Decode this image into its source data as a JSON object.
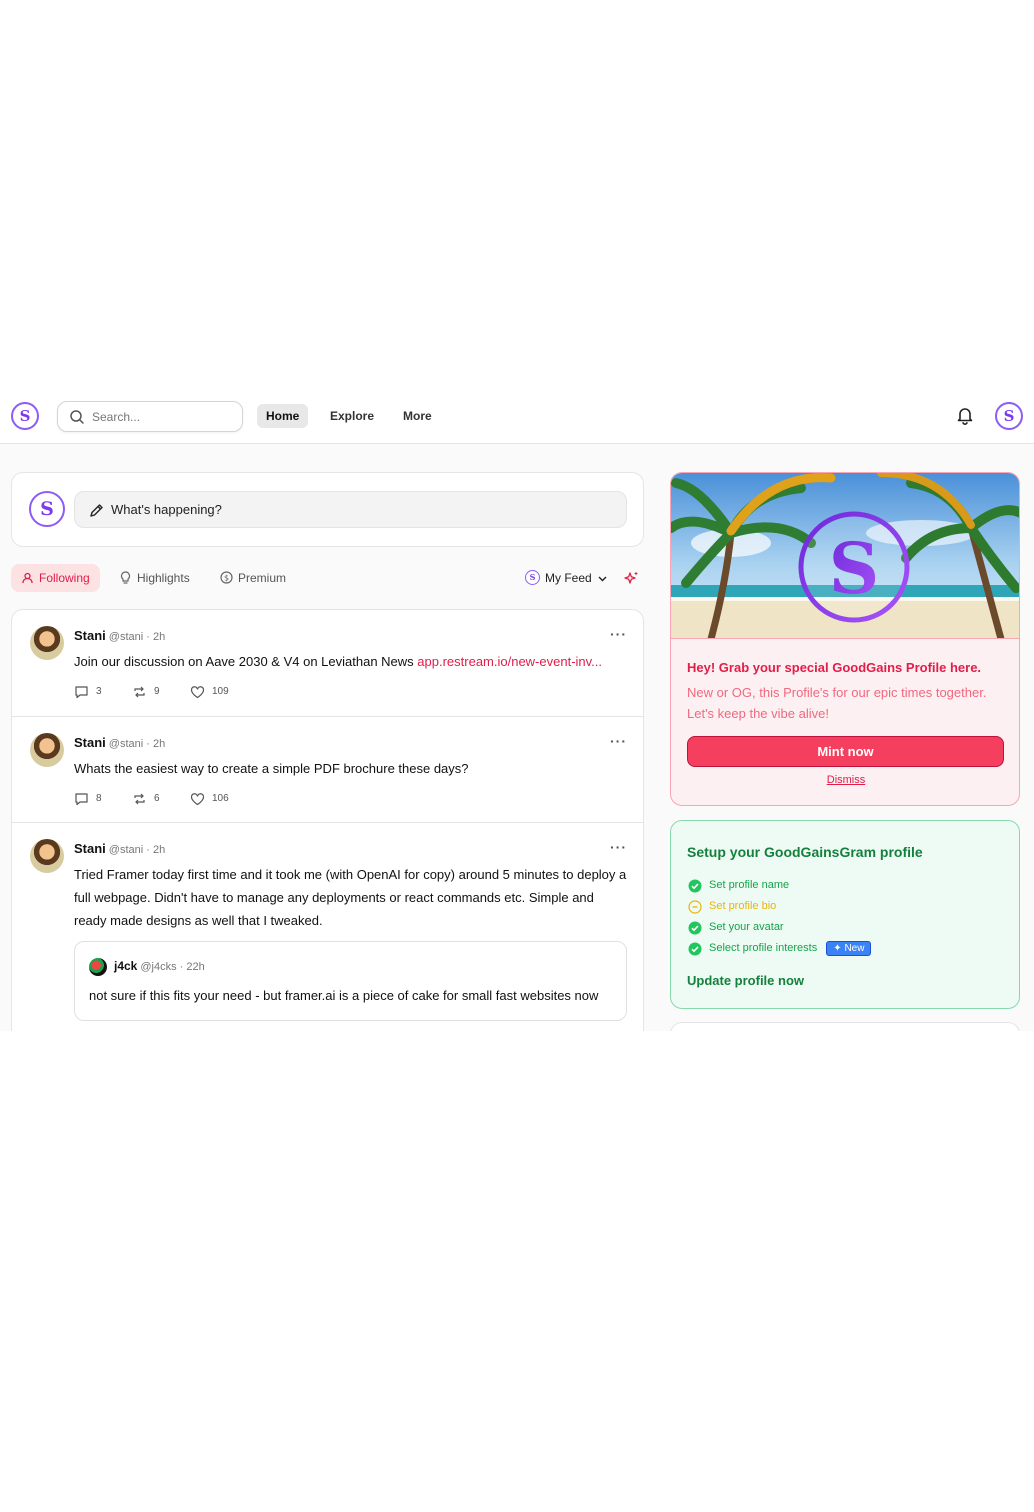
{
  "nav": {
    "logo_letter": "S",
    "search_placeholder": "Search...",
    "links": [
      "Home",
      "Explore",
      "More"
    ],
    "active": "Home"
  },
  "composer": {
    "placeholder": "What's happening?"
  },
  "feed_tabs": {
    "items": [
      "Following",
      "Highlights",
      "Premium"
    ],
    "active": "Following",
    "feed_selector": "My Feed"
  },
  "posts": [
    {
      "name": "Stani",
      "handle": "@stani",
      "time": "· 2h",
      "text": "Join our discussion on Aave 2030 & V4 on Leviathan News ",
      "link": "app.restream.io/new-event-inv...",
      "comments": "3",
      "reposts": "9",
      "likes": "109"
    },
    {
      "name": "Stani",
      "handle": "@stani",
      "time": "· 2h",
      "text": "Whats the easiest way to create a simple PDF brochure these days?",
      "comments": "8",
      "reposts": "6",
      "likes": "106"
    },
    {
      "name": "Stani",
      "handle": "@stani",
      "time": "· 2h",
      "text": "Tried Framer today first time and it took me (with OpenAI for copy) around 5 minutes to deploy a full webpage. Didn't have to manage any deployments or react commands etc. Simple and ready made designs as well that I tweaked.",
      "quote": {
        "name": "j4ck",
        "handle": "@j4cks",
        "time": "· 22h",
        "text": "not sure if this fits your need - but framer.ai is a piece of cake for small fast websites now"
      }
    }
  ],
  "mint_card": {
    "title": "Hey! Grab your special GoodGains Profile here.",
    "description": "New or OG, this Profile's for our epic times together. Let's keep the vibe alive!",
    "button": "Mint now",
    "dismiss": "Dismiss"
  },
  "setup_card": {
    "title": "Setup your GoodGainsGram profile",
    "steps": [
      {
        "label": "Set profile name",
        "done": true
      },
      {
        "label": "Set profile bio",
        "done": false
      },
      {
        "label": "Set your avatar",
        "done": true
      },
      {
        "label": "Select profile interests",
        "done": true
      }
    ],
    "new_badge": "New",
    "cta": "Update profile now"
  },
  "colors": {
    "accent": "#e11d48",
    "brand": "#8b5cf6",
    "success": "#16a34a",
    "pending": "#eab308"
  }
}
